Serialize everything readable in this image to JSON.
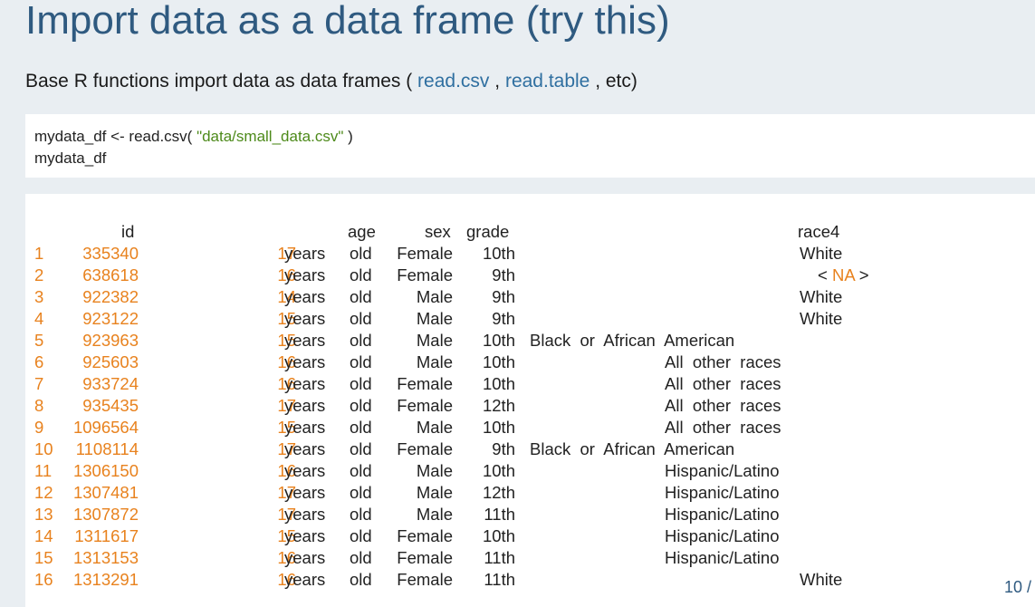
{
  "slide": {
    "title": "Import data as a data frame (try this)",
    "subtitle_prefix": "Base R functions import data as data frames (",
    "fn1": "read.csv",
    "sep": ",",
    "fn2": "read.table",
    "subtitle_suffix": ", etc)",
    "page": "10 /"
  },
  "code": {
    "line1_prefix": "mydata_df  <-  read.csv(",
    "line1_string": "\"data/small_data.csv\"",
    "line1_suffix": ")",
    "line2": "mydata_df"
  },
  "table": {
    "headers": {
      "id": "id",
      "age": "age",
      "sex": "sex",
      "grade": "grade",
      "race4": "race4"
    },
    "rows": [
      {
        "n": "1",
        "id": "335340",
        "age_num": "17",
        "years": "years",
        "old": "old",
        "sex": "Female",
        "grade": "10th",
        "race": "White"
      },
      {
        "n": "2",
        "id": "638618",
        "age_num": "16",
        "years": "years",
        "old": "old",
        "sex": "Female",
        "grade": "9th",
        "race": "NA"
      },
      {
        "n": "3",
        "id": "922382",
        "age_num": "14",
        "years": "years",
        "old": "old",
        "sex": "Male",
        "grade": "9th",
        "race": "White"
      },
      {
        "n": "4",
        "id": "923122",
        "age_num": "15",
        "years": "years",
        "old": "old",
        "sex": "Male",
        "grade": "9th",
        "race": "White"
      },
      {
        "n": "5",
        "id": "923963",
        "age_num": "15",
        "years": "years",
        "old": "old",
        "sex": "Male",
        "grade": "10th",
        "race": "Black  or  African  American"
      },
      {
        "n": "6",
        "id": "925603",
        "age_num": "16",
        "years": "years",
        "old": "old",
        "sex": "Male",
        "grade": "10th",
        "race": "All  other  races"
      },
      {
        "n": "7",
        "id": "933724",
        "age_num": "16",
        "years": "years",
        "old": "old",
        "sex": "Female",
        "grade": "10th",
        "race": "All  other  races"
      },
      {
        "n": "8",
        "id": "935435",
        "age_num": "17",
        "years": "years",
        "old": "old",
        "sex": "Female",
        "grade": "12th",
        "race": "All  other  races"
      },
      {
        "n": "9",
        "id": "1096564",
        "age_num": "15",
        "years": "years",
        "old": "old",
        "sex": "Male",
        "grade": "10th",
        "race": "All  other  races"
      },
      {
        "n": "10",
        "id": "1108114",
        "age_num": "17",
        "years": "years",
        "old": "old",
        "sex": "Female",
        "grade": "9th",
        "race": "Black  or  African  American"
      },
      {
        "n": "11",
        "id": "1306150",
        "age_num": "16",
        "years": "years",
        "old": "old",
        "sex": "Male",
        "grade": "10th",
        "race": "Hispanic/Latino"
      },
      {
        "n": "12",
        "id": "1307481",
        "age_num": "17",
        "years": "years",
        "old": "old",
        "sex": "Male",
        "grade": "12th",
        "race": "Hispanic/Latino"
      },
      {
        "n": "13",
        "id": "1307872",
        "age_num": "17",
        "years": "years",
        "old": "old",
        "sex": "Male",
        "grade": "11th",
        "race": "Hispanic/Latino"
      },
      {
        "n": "14",
        "id": "1311617",
        "age_num": "15",
        "years": "years",
        "old": "old",
        "sex": "Female",
        "grade": "10th",
        "race": "Hispanic/Latino"
      },
      {
        "n": "15",
        "id": "1313153",
        "age_num": "16",
        "years": "years",
        "old": "old",
        "sex": "Female",
        "grade": "11th",
        "race": "Hispanic/Latino"
      },
      {
        "n": "16",
        "id": "1313291",
        "age_num": "16",
        "years": "years",
        "old": "old",
        "sex": "Female",
        "grade": "11th",
        "race": "White"
      }
    ]
  }
}
